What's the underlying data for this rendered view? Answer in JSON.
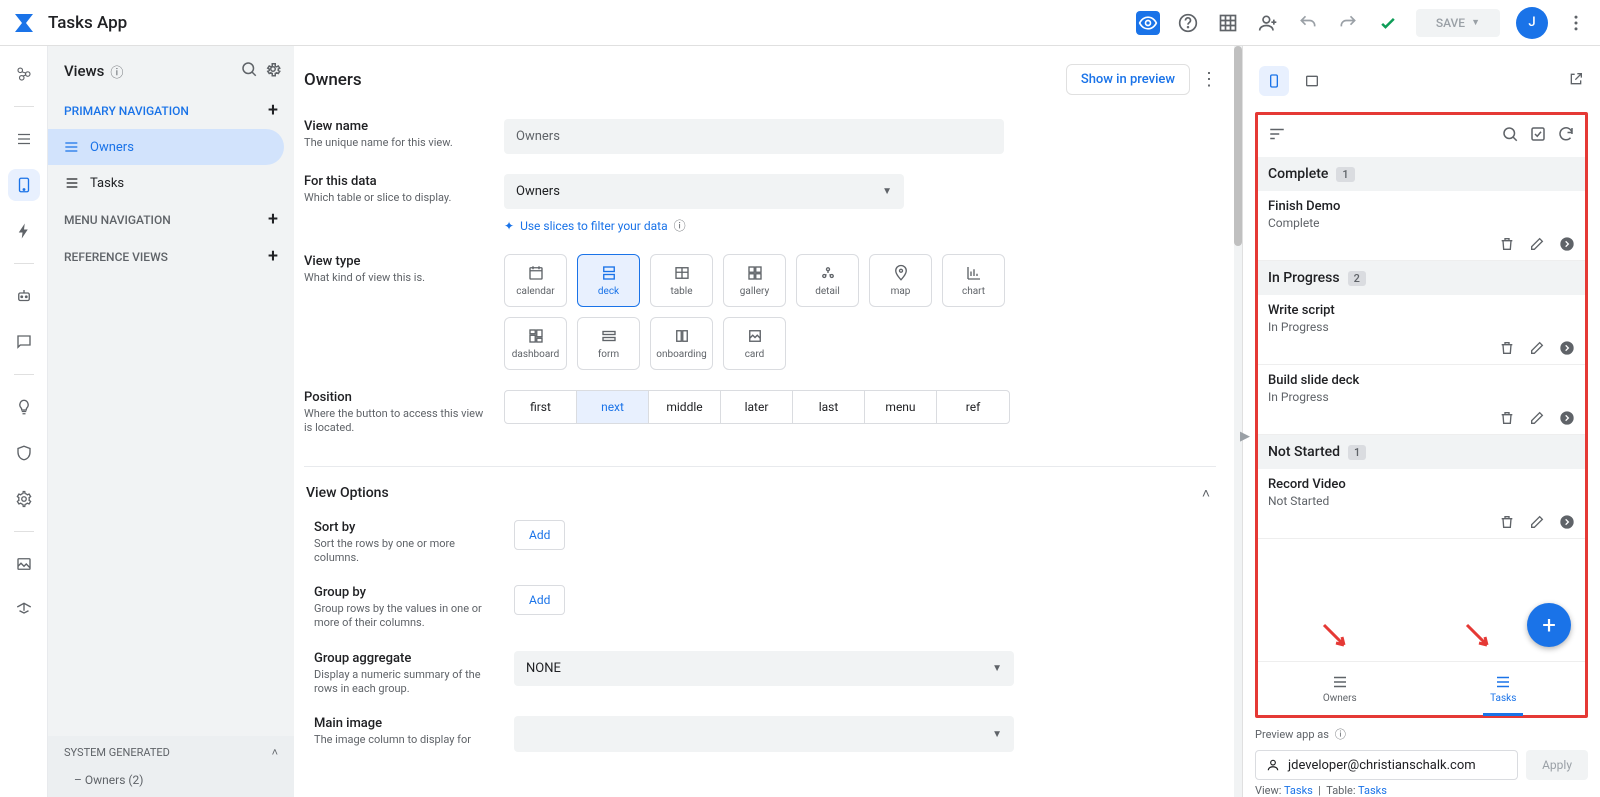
{
  "app_title": "Tasks App",
  "topbar": {
    "save_label": "SAVE",
    "avatar_letter": "J"
  },
  "views_panel": {
    "title": "Views",
    "categories": {
      "primary": "PRIMARY NAVIGATION",
      "menu": "MENU NAVIGATION",
      "ref": "REFERENCE VIEWS",
      "system": "SYSTEM GENERATED"
    },
    "items": {
      "owners": "Owners",
      "tasks": "Tasks",
      "owners2": "Owners (2)"
    }
  },
  "editor": {
    "heading": "Owners",
    "show_in_preview": "Show in preview",
    "view_name": {
      "label": "View name",
      "desc": "The unique name for this view.",
      "value": "Owners"
    },
    "for_data": {
      "label": "For this data",
      "desc": "Which table or slice to display.",
      "value": "Owners",
      "slice_hint": "Use slices to filter your data"
    },
    "view_type": {
      "label": "View type",
      "desc": "What kind of view this is.",
      "options": [
        "calendar",
        "deck",
        "table",
        "gallery",
        "detail",
        "map",
        "chart",
        "dashboard",
        "form",
        "onboarding",
        "card"
      ],
      "active": "deck"
    },
    "position": {
      "label": "Position",
      "desc": "Where the button to access this view is located.",
      "options": [
        "first",
        "next",
        "middle",
        "later",
        "last",
        "menu",
        "ref"
      ],
      "active": "next"
    },
    "section_options": "View Options",
    "sort_by": {
      "label": "Sort by",
      "desc": "Sort the rows by one or more columns.",
      "add": "Add"
    },
    "group_by": {
      "label": "Group by",
      "desc": "Group rows by the values in one or more of their columns.",
      "add": "Add"
    },
    "group_agg": {
      "label": "Group aggregate",
      "desc": "Display a numeric summary of the rows in each group.",
      "value": "NONE"
    },
    "main_image": {
      "label": "Main image",
      "desc": "The image column to display for"
    }
  },
  "preview": {
    "groups": [
      {
        "name": "Complete",
        "count": "1",
        "items": [
          {
            "title": "Finish Demo",
            "status": "Complete"
          }
        ]
      },
      {
        "name": "In Progress",
        "count": "2",
        "items": [
          {
            "title": "Write script",
            "status": "In Progress"
          },
          {
            "title": "Build slide deck",
            "status": "In Progress"
          }
        ]
      },
      {
        "name": "Not Started",
        "count": "1",
        "items": [
          {
            "title": "Record Video",
            "status": "Not Started"
          }
        ]
      }
    ],
    "bottom_tabs": {
      "owners": "Owners",
      "tasks": "Tasks"
    },
    "preview_as": "Preview app as",
    "user": "jdeveloper@christianschalk.com",
    "apply": "Apply",
    "footer": {
      "view_label": "View:",
      "view_value": "Tasks",
      "table_label": "Table:",
      "table_value": "Tasks"
    }
  }
}
